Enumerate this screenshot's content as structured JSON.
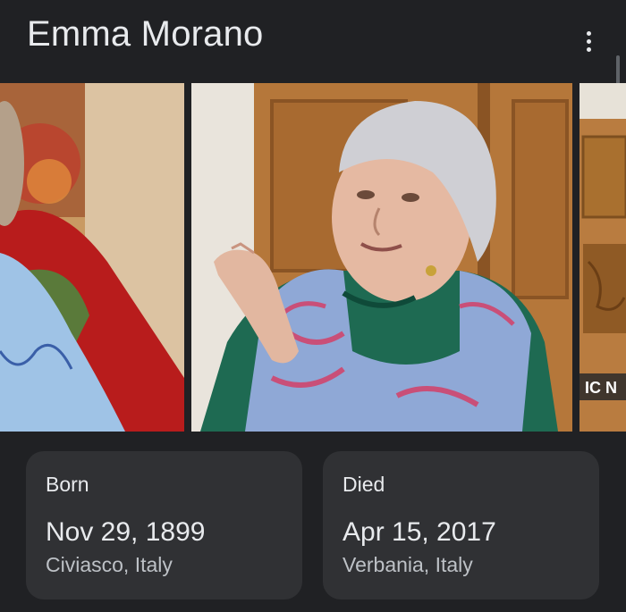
{
  "header": {
    "title": "Emma Morano",
    "menu_icon": "more-vert-icon"
  },
  "gallery": {
    "photos": [
      {
        "label": "photo-left-partial"
      },
      {
        "label": "photo-main-portrait"
      },
      {
        "label": "photo-right-partial",
        "watermark": "IC N"
      }
    ]
  },
  "facts": {
    "born": {
      "label": "Born",
      "date": "Nov 29, 1899",
      "place": "Civiasco, Italy"
    },
    "died": {
      "label": "Died",
      "date": "Apr 15, 2017",
      "place": "Verbania, Italy"
    }
  },
  "colors": {
    "background": "#202124",
    "card": "#303134",
    "text_primary": "#e8eaed",
    "text_secondary": "#bdc1c6"
  }
}
